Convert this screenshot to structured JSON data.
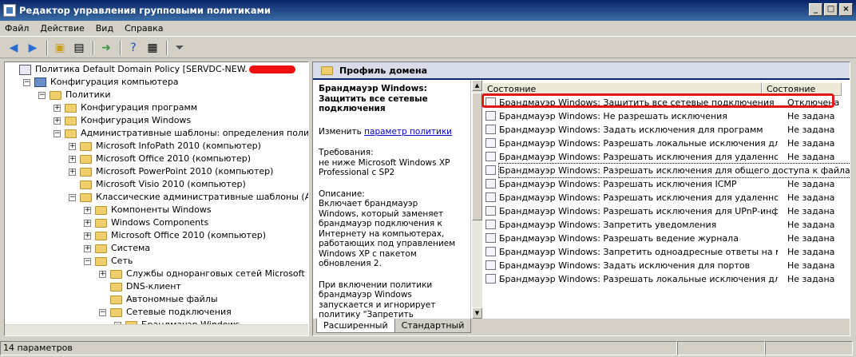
{
  "window": {
    "title": "Редактор управления групповыми политиками"
  },
  "menu": [
    "Файл",
    "Действие",
    "Вид",
    "Справка"
  ],
  "toolbar": [
    "back-icon",
    "forward-icon",
    "up-folder-icon",
    "show-tree-icon",
    "export-icon",
    "help-icon",
    "properties-icon",
    "filter-icon"
  ],
  "tree": [
    {
      "label": "Политика Default Domain Policy [SERVDC-NEW.",
      "indent": 0,
      "exp": "",
      "icon": "policy",
      "redacted": true
    },
    {
      "label": "Конфигурация компьютера",
      "indent": 1,
      "exp": "−",
      "icon": "computer"
    },
    {
      "label": "Политики",
      "indent": 2,
      "exp": "−",
      "icon": "folder"
    },
    {
      "label": "Конфигурация программ",
      "indent": 3,
      "exp": "+",
      "icon": "folder"
    },
    {
      "label": "Конфигурация Windows",
      "indent": 3,
      "exp": "+",
      "icon": "folder"
    },
    {
      "label": "Административные шаблоны: определения политик (AI",
      "indent": 3,
      "exp": "−",
      "icon": "folder"
    },
    {
      "label": "Microsoft InfoPath 2010 (компьютер)",
      "indent": 4,
      "exp": "+",
      "icon": "folder"
    },
    {
      "label": "Microsoft Office 2010 (компьютер)",
      "indent": 4,
      "exp": "+",
      "icon": "folder"
    },
    {
      "label": "Microsoft PowerPoint 2010 (компьютер)",
      "indent": 4,
      "exp": "+",
      "icon": "folder"
    },
    {
      "label": "Microsoft Visio 2010 (компьютер)",
      "indent": 4,
      "exp": "",
      "icon": "folder"
    },
    {
      "label": "Классические административные шаблоны (ADM)",
      "indent": 4,
      "exp": "−",
      "icon": "folder"
    },
    {
      "label": "Компоненты Windows",
      "indent": 5,
      "exp": "+",
      "icon": "folder"
    },
    {
      "label": "Windows Components",
      "indent": 5,
      "exp": "+",
      "icon": "folder"
    },
    {
      "label": "Microsoft Office 2010 (компьютер)",
      "indent": 5,
      "exp": "+",
      "icon": "folder"
    },
    {
      "label": "Система",
      "indent": 5,
      "exp": "+",
      "icon": "folder"
    },
    {
      "label": "Сеть",
      "indent": 5,
      "exp": "−",
      "icon": "folder"
    },
    {
      "label": "Службы одноранговых сетей Microsoft",
      "indent": 6,
      "exp": "+",
      "icon": "folder"
    },
    {
      "label": "DNS-клиент",
      "indent": 6,
      "exp": "",
      "icon": "folder"
    },
    {
      "label": "Автономные файлы",
      "indent": 6,
      "exp": "",
      "icon": "folder"
    },
    {
      "label": "Сетевые подключения",
      "indent": 6,
      "exp": "−",
      "icon": "folder"
    },
    {
      "label": "Брандмауэр Windows",
      "indent": 7,
      "exp": "−",
      "icon": "folder"
    }
  ],
  "right": {
    "header": "Профиль домена",
    "description": {
      "title": "Брандмауэр Windows: Защитить все сетевые подключения",
      "edit_prefix": "Изменить",
      "edit_link": "параметр политики",
      "requirements_label": "Требования:",
      "requirements": "не ниже Microsoft Windows XP Professional с SP2",
      "desc_label": "Описание:",
      "desc_text": "Включает брандмауэр Windows, который заменяет брандмауэр подключения к Интернету на компьютерах, работающих под управлением Windows XP с пакетом обновления 2.",
      "desc_more": "При включении политики брандмауэр Windows запускается и игнорирует политику \"Запретить использование брандмауэра подключения к Интернету в сети DNS-домена\" в"
    },
    "columns": [
      "Состояние",
      "Состояние"
    ],
    "rows": [
      {
        "name": "Брандмауэр Windows: Защитить все сетевые подключения",
        "state": "Отключена"
      },
      {
        "name": "Брандмауэр Windows: Не разрешать исключения",
        "state": "Не задана"
      },
      {
        "name": "Брандмауэр Windows: Задать исключения для программ",
        "state": "Не задана"
      },
      {
        "name": "Брандмауэр Windows: Разрешать локальные исключения для...",
        "state": "Не задана"
      },
      {
        "name": "Брандмауэр Windows: Разрешать исключения для удаленног...",
        "state": "Не задана"
      },
      {
        "name": "Брандмауэр Windows: Разрешать исключения для общего доступа к файлам и принтерам",
        "state": ""
      },
      {
        "name": "Брандмауэр Windows: Разрешать исключения ICMP",
        "state": "Не задана"
      },
      {
        "name": "Брандмауэр Windows: Разрешать исключения для удаленног...",
        "state": "Не задана"
      },
      {
        "name": "Брандмауэр Windows: Разрешать исключения для UPnP-инфр...",
        "state": "Не задана"
      },
      {
        "name": "Брандмауэр Windows: Запретить уведомления",
        "state": "Не задана"
      },
      {
        "name": "Брандмауэр Windows: Разрешать ведение журнала",
        "state": "Не задана"
      },
      {
        "name": "Брандмауэр Windows: Запретить одноадресные ответы на м...",
        "state": "Не задана"
      },
      {
        "name": "Брандмауэр Windows: Задать исключения для портов",
        "state": "Не задана"
      },
      {
        "name": "Брандмауэр Windows: Разрешать локальные исключения для...",
        "state": "Не задана"
      }
    ],
    "tabs": [
      "Расширенный",
      "Стандартный"
    ]
  },
  "status": {
    "text": "14 параметров"
  },
  "colors": {
    "title": "#0a246a",
    "highlight": "#e31515",
    "link": "#0000cc"
  }
}
